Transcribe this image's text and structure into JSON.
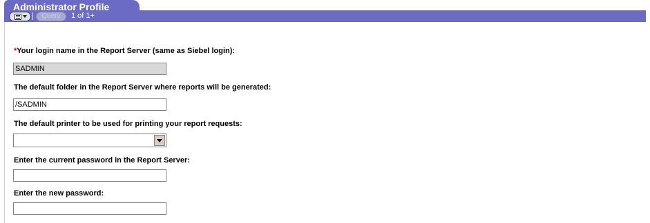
{
  "applet": {
    "title": "Administrator Profile",
    "query_label": "Query",
    "record_count": "1 of 1+"
  },
  "form": {
    "login": {
      "required_marker": "*",
      "label": "Your login name in the Report Server (same as Siebel login):",
      "value": "SADMIN"
    },
    "folder": {
      "label": "The default folder in the Report Server where reports will be generated:",
      "value": "/SADMIN"
    },
    "printer": {
      "label": "The default printer to be used for printing your report requests:",
      "value": ""
    },
    "current_password": {
      "label": "Enter the current password in the Report Server:",
      "value": ""
    },
    "new_password": {
      "label": "Enter the new password:",
      "value": ""
    }
  },
  "colors": {
    "header": "#6b6bc6",
    "required": "#cc0000",
    "readonly_field": "#d8d8d8"
  },
  "icons": [
    "applet-menu-icon",
    "dropdown-arrow-icon"
  ]
}
